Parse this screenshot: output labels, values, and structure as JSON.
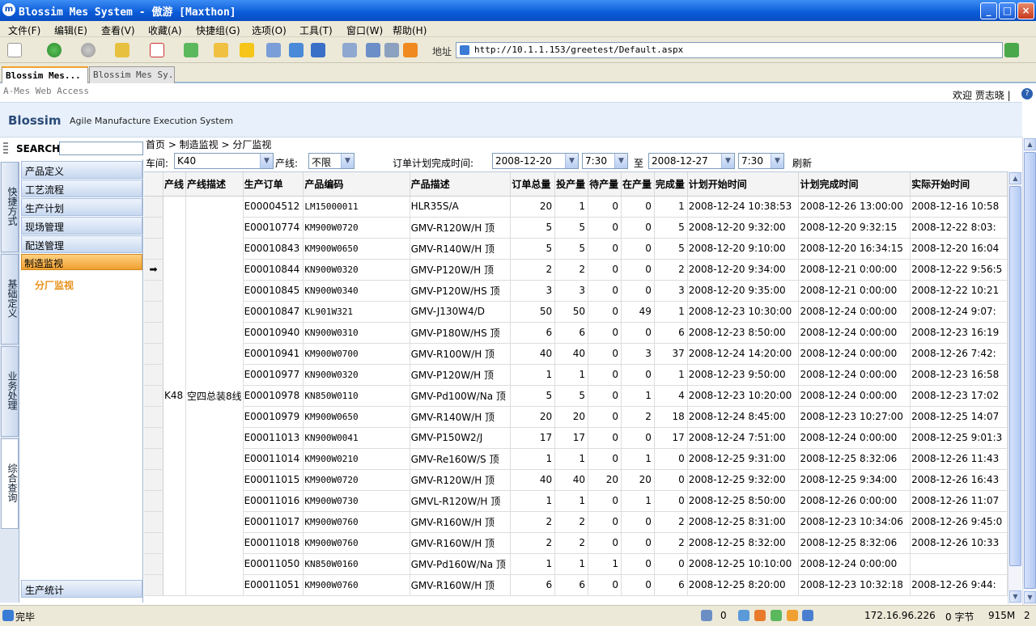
{
  "window": {
    "title": "Blossim Mes System - 傲游 [Maxthon]",
    "min": "_",
    "max": "□",
    "close": "×"
  },
  "menubar": [
    "文件(F)",
    "编辑(E)",
    "查看(V)",
    "收藏(A)",
    "快捷组(G)",
    "选项(O)",
    "工具(T)",
    "窗口(W)",
    "帮助(H)"
  ],
  "address": {
    "label": "地址",
    "url": "http://10.1.1.153/greetest/Default.aspx"
  },
  "tabs": [
    {
      "label": "Blossim Mes..."
    },
    {
      "label": "Blossim Mes Sy..."
    }
  ],
  "page": {
    "access": "A-Mes Web Access",
    "welcome": "欢迎 贾志晓 |",
    "help": "?",
    "brand": "Blossim",
    "brand_sub": "Agile Manufacture Execution System"
  },
  "sidebar": {
    "search_label": "SEARCH",
    "vtabs": [
      "快捷方式",
      "基础定义",
      "业务处理",
      "综合查询"
    ],
    "items": [
      "产品定义",
      "工艺流程",
      "生产计划",
      "现场管理",
      "配送管理",
      "制造监视"
    ],
    "sub_item": "分厂监视",
    "bottom_item": "生产统计"
  },
  "breadcrumb": "首页 > 制造监视 > 分厂监视",
  "filters": {
    "workshop_label": "车间:",
    "workshop_value": "K40",
    "line_label": "产线:",
    "line_value": "不限",
    "date_label": "订单计划完成时间:",
    "from_date": "2008-12-20",
    "from_time": "7:30",
    "to_label": "至",
    "to_date": "2008-12-27",
    "to_time": "7:30",
    "refresh": "刷新"
  },
  "table": {
    "columns": [
      "产线",
      "产线描述",
      "生产订单",
      "产品编码",
      "产品描述",
      "订单总量",
      "投产量",
      "待产量",
      "在产量",
      "完成量",
      "计划开始时间",
      "计划完成时间",
      "实际开始时间"
    ],
    "line": "K48",
    "line_desc": "空四总装8线",
    "current_marker": "➡",
    "rows": [
      [
        "E00004512",
        "LM15000011",
        "HLR35S/A",
        "20",
        "1",
        "0",
        "0",
        "1",
        "2008-12-24 10:38:53",
        "2008-12-26 13:00:00",
        "2008-12-16 10:58"
      ],
      [
        "E00010774",
        "KM900W0720",
        "GMV-R120W/H 顶",
        "5",
        "5",
        "0",
        "0",
        "5",
        "2008-12-20 9:32:00",
        "2008-12-20 9:32:15",
        "2008-12-22 8:03:"
      ],
      [
        "E00010843",
        "KM900W0650",
        "GMV-R140W/H 顶",
        "5",
        "5",
        "0",
        "0",
        "5",
        "2008-12-20 9:10:00",
        "2008-12-20 16:34:15",
        "2008-12-20 16:04"
      ],
      [
        "E00010844",
        "KN900W0320",
        "GMV-P120W/H 顶",
        "2",
        "2",
        "0",
        "0",
        "2",
        "2008-12-20 9:34:00",
        "2008-12-21 0:00:00",
        "2008-12-22 9:56:5"
      ],
      [
        "E00010845",
        "KN900W0340",
        "GMV-P120W/HS 顶",
        "3",
        "3",
        "0",
        "0",
        "3",
        "2008-12-20 9:35:00",
        "2008-12-21 0:00:00",
        "2008-12-22 10:21"
      ],
      [
        "E00010847",
        "KL901W321",
        "GMV-J130W4/D",
        "50",
        "50",
        "0",
        "49",
        "1",
        "2008-12-23 10:30:00",
        "2008-12-24 0:00:00",
        "2008-12-24 9:07:"
      ],
      [
        "E00010940",
        "KN900W0310",
        "GMV-P180W/HS 顶",
        "6",
        "6",
        "0",
        "0",
        "6",
        "2008-12-23 8:50:00",
        "2008-12-24 0:00:00",
        "2008-12-23 16:19"
      ],
      [
        "E00010941",
        "KM900W0700",
        "GMV-R100W/H 顶",
        "40",
        "40",
        "0",
        "3",
        "37",
        "2008-12-24 14:20:00",
        "2008-12-24 0:00:00",
        "2008-12-26 7:42:"
      ],
      [
        "E00010977",
        "KN900W0320",
        "GMV-P120W/H 顶",
        "1",
        "1",
        "0",
        "0",
        "1",
        "2008-12-23 9:50:00",
        "2008-12-24 0:00:00",
        "2008-12-23 16:58"
      ],
      [
        "E00010978",
        "KN850W0110",
        "GMV-Pd100W/Na 顶",
        "5",
        "5",
        "0",
        "1",
        "4",
        "2008-12-23 10:20:00",
        "2008-12-24 0:00:00",
        "2008-12-23 17:02"
      ],
      [
        "E00010979",
        "KM900W0650",
        "GMV-R140W/H 顶",
        "20",
        "20",
        "0",
        "2",
        "18",
        "2008-12-24 8:45:00",
        "2008-12-23 10:27:00",
        "2008-12-25 14:07"
      ],
      [
        "E00011013",
        "KN900W0041",
        "GMV-P150W2/J",
        "17",
        "17",
        "0",
        "0",
        "17",
        "2008-12-24 7:51:00",
        "2008-12-24 0:00:00",
        "2008-12-25 9:01:3"
      ],
      [
        "E00011014",
        "KM900W0210",
        "GMV-Re160W/S 顶",
        "1",
        "1",
        "0",
        "1",
        "0",
        "2008-12-25 9:31:00",
        "2008-12-25 8:32:06",
        "2008-12-26 11:43"
      ],
      [
        "E00011015",
        "KM900W0720",
        "GMV-R120W/H 顶",
        "40",
        "40",
        "20",
        "20",
        "0",
        "2008-12-25 9:32:00",
        "2008-12-25 9:34:00",
        "2008-12-26 16:43"
      ],
      [
        "E00011016",
        "KM900W0730",
        "GMVL-R120W/H 顶",
        "1",
        "1",
        "0",
        "1",
        "0",
        "2008-12-25 8:50:00",
        "2008-12-26 0:00:00",
        "2008-12-26 11:07"
      ],
      [
        "E00011017",
        "KM900W0760",
        "GMV-R160W/H 顶",
        "2",
        "2",
        "0",
        "0",
        "2",
        "2008-12-25 8:31:00",
        "2008-12-23 10:34:06",
        "2008-12-26 9:45:0"
      ],
      [
        "E00011018",
        "KM900W0760",
        "GMV-R160W/H 顶",
        "2",
        "2",
        "0",
        "0",
        "2",
        "2008-12-25 8:32:00",
        "2008-12-25 8:32:06",
        "2008-12-26 10:33"
      ],
      [
        "E00011050",
        "KN850W0160",
        "GMV-Pd160W/Na 顶",
        "1",
        "1",
        "1",
        "0",
        "0",
        "2008-12-25 10:10:00",
        "2008-12-24 0:00:00",
        ""
      ],
      [
        "E00011051",
        "KM900W0760",
        "GMV-R160W/H 顶",
        "6",
        "6",
        "0",
        "0",
        "6",
        "2008-12-25 8:20:00",
        "2008-12-23 10:32:18",
        "2008-12-26 9:44:"
      ]
    ]
  },
  "status": {
    "text": "完毕",
    "count": "0",
    "ip": "172.16.96.226",
    "bytes": "0 字节",
    "mem": "915M",
    "num": "2"
  }
}
